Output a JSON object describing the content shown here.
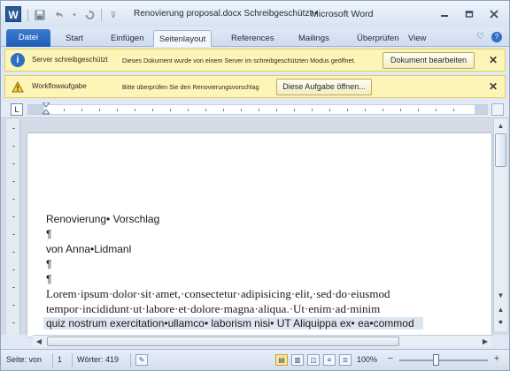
{
  "window": {
    "app_icon_letter": "W",
    "document_title": "Renovierung proposal.docx Schreibgeschützt •",
    "app_name": "Microsoft Word"
  },
  "qat": {
    "save_icon": "save-icon",
    "undo_icon": "undo-icon",
    "redo_icon": "redo-icon",
    "customize_icon": "customize-icon"
  },
  "ribbon": {
    "tabs": [
      "Datei",
      "Start",
      "Einfügen",
      "Seitenlayout",
      "References",
      "Mailings",
      "Überprüfen",
      "View"
    ]
  },
  "message_bars": [
    {
      "title": "Server schreibgeschützt",
      "text": "Dieses Dokument wurde von einem Server im schreibgeschützten Modus geöffnet.",
      "button": "Dokument bearbeiten",
      "icon": "info-icon"
    },
    {
      "title": "Workflowaufgabe",
      "text": "Bitte überprüfen Sie den Renovierungsvorschlag",
      "button": "Diese Aufgabe öffnen...",
      "icon": "warning-icon"
    }
  ],
  "document": {
    "lines": [
      "Renovierung• Vorschlag",
      "¶",
      "von Anna•Lidmanl",
      "¶",
      "¶",
      "Lorem·ipsum·dolor·sit·amet,·consectetur·adipisicing·elit,·sed·do·eiusmod",
      "tempor·incididunt·ut·labore·et·dolore·magna·aliqua.·Ut·enim·ad·minim",
      "quiz nostrum exercitation•ullamco• laborism nisi• UT Aliquippa ex• ea•commod"
    ]
  },
  "statusbar": {
    "page_label": "Seite: von",
    "page_value": "1",
    "words_label": "Wörter: 419",
    "zoom": "100%"
  },
  "colors": {
    "file_tab": "#1f5cb7",
    "message_bar": "#fdf5b7",
    "info_icon": "#2f6fc4"
  }
}
